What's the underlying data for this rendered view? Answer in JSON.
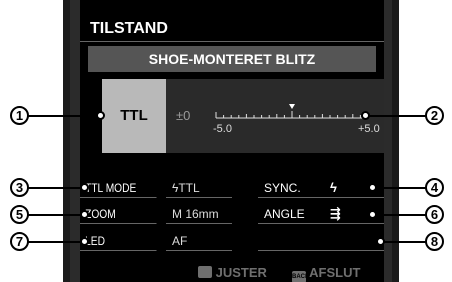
{
  "screen": {
    "title": "TILSTAND",
    "subtitle": "SHOE-MONTERET BLITZ"
  },
  "flash_control": {
    "mode_label": "TTL",
    "compensation_value": "±0",
    "scale_min": "-5.0",
    "scale_max": "+5.0"
  },
  "settings": {
    "ttl_mode": {
      "label": "TTL MODE",
      "value": "ϟTTL"
    },
    "sync": {
      "label": "SYNC.",
      "icon": "front-curtain-sync-icon"
    },
    "zoom": {
      "label": "ZOOM",
      "value": "M 16mm"
    },
    "angle": {
      "label": "ANGLE",
      "icon": "flash-angle-icon"
    },
    "led": {
      "label": "LED",
      "value": "AF"
    }
  },
  "footer": {
    "adjust_label": "JUSTER",
    "back_key": "BACK",
    "exit_label": "AFSLUT"
  },
  "callouts": {
    "c1": "1",
    "c2": "2",
    "c3": "3",
    "c4": "4",
    "c5": "5",
    "c6": "6",
    "c7": "7",
    "c8": "8"
  }
}
